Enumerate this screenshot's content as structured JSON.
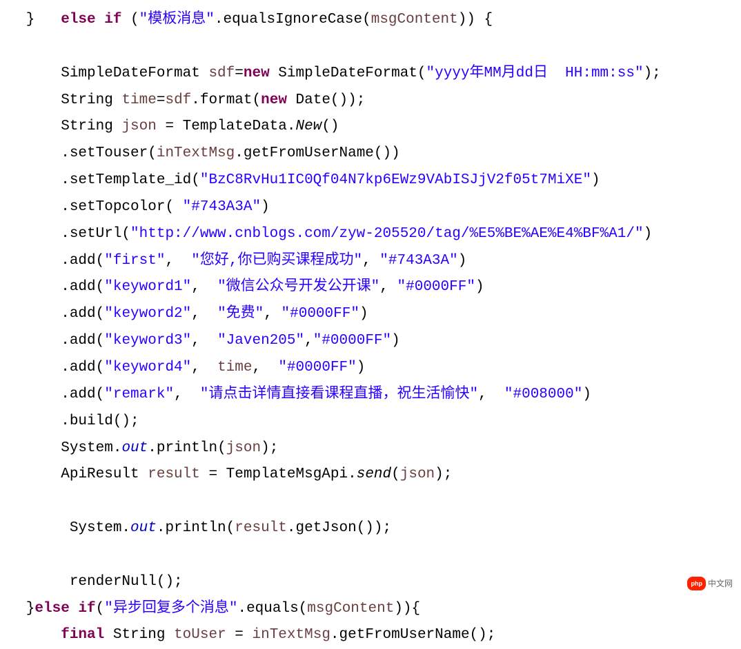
{
  "code": {
    "l1": {
      "a": "   }   ",
      "b": "else if",
      "c": " (",
      "d": "\"模板消息\"",
      "e": ".equalsIgnoreCase(",
      "f": "msgContent",
      "g": ")) {"
    },
    "l2": "",
    "l3": {
      "a": "       SimpleDateFormat ",
      "b": "sdf",
      "c": "=",
      "d": "new",
      "e": " SimpleDateFormat(",
      "f": "\"yyyy年MM月dd日  HH:mm:ss\"",
      "g": ");"
    },
    "l4": {
      "a": "       String ",
      "b": "time",
      "c": "=",
      "d": "sdf",
      "e": ".format(",
      "f": "new",
      "g": " Date());"
    },
    "l5": {
      "a": "       String ",
      "b": "json",
      "c": " = TemplateData.",
      "d": "New",
      "e": "()"
    },
    "l6": {
      "a": "       .setTouser(",
      "b": "inTextMsg",
      "c": ".getFromUserName())"
    },
    "l7": {
      "a": "       .setTemplate_id(",
      "b": "\"BzC8RvHu1IC0Qf04N7kp6EWz9VAbISJjV2f05t7MiXE\"",
      "c": ")"
    },
    "l8": {
      "a": "       .setTopcolor( ",
      "b": "\"#743A3A\"",
      "c": ")"
    },
    "l9": {
      "a": "       .setUrl(",
      "b": "\"http://www.cnblogs.com/zyw-205520/tag/%E5%BE%AE%E4%BF%A1/\"",
      "c": ")"
    },
    "l10": {
      "a": "       .add(",
      "b": "\"first\"",
      "c": ",  ",
      "d": "\"您好,你已购买课程成功\"",
      "e": ", ",
      "f": "\"#743A3A\"",
      "g": ")"
    },
    "l11": {
      "a": "       .add(",
      "b": "\"keyword1\"",
      "c": ",  ",
      "d": "\"微信公众号开发公开课\"",
      "e": ", ",
      "f": "\"#0000FF\"",
      "g": ")"
    },
    "l12": {
      "a": "       .add(",
      "b": "\"keyword2\"",
      "c": ",  ",
      "d": "\"免费\"",
      "e": ", ",
      "f": "\"#0000FF\"",
      "g": ")"
    },
    "l13": {
      "a": "       .add(",
      "b": "\"keyword3\"",
      "c": ",  ",
      "d": "\"Javen205\"",
      "e": ",",
      "f": "\"#0000FF\"",
      "g": ")"
    },
    "l14": {
      "a": "       .add(",
      "b": "\"keyword4\"",
      "c": ",  ",
      "d": "time",
      "e": ",  ",
      "f": "\"#0000FF\"",
      "g": ")"
    },
    "l15": {
      "a": "       .add(",
      "b": "\"remark\"",
      "c": ",  ",
      "d": "\"请点击详情直接看课程直播，祝生活愉快\"",
      "e": ",  ",
      "f": "\"#008000\"",
      "g": ")"
    },
    "l16": {
      "a": "       .build();"
    },
    "l17": {
      "a": "       System.",
      "b": "out",
      "c": ".println(",
      "d": "json",
      "e": ");"
    },
    "l18": {
      "a": "       ApiResult ",
      "b": "result",
      "c": " = TemplateMsgApi.",
      "d": "send",
      "e": "(",
      "f": "json",
      "g": ");"
    },
    "l19": "",
    "l20": {
      "a": "        System.",
      "b": "out",
      "c": ".println(",
      "d": "result",
      "e": ".getJson());"
    },
    "l21": "",
    "l22": {
      "a": "        renderNull();"
    },
    "l23": {
      "a": "   }",
      "b": "else if",
      "c": "(",
      "d": "\"异步回复多个消息\"",
      "e": ".equals(",
      "f": "msgContent",
      "g": ")){"
    },
    "l24": {
      "a": "       ",
      "b": "final",
      "c": " String ",
      "d": "toUser",
      "e": " = ",
      "f": "inTextMsg",
      "g": ".getFromUserName();"
    }
  },
  "watermark": {
    "logo": "php",
    "text": "中文网"
  }
}
